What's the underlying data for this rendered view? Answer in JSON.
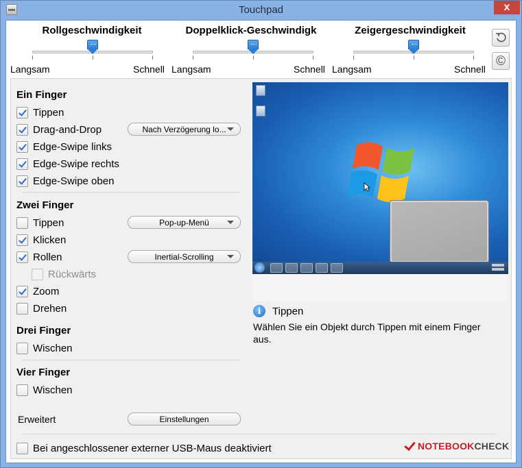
{
  "window": {
    "title": "Touchpad",
    "close_glyph": "x"
  },
  "sliders": [
    {
      "label": "Rollgeschwindigkeit",
      "min_label": "Langsam",
      "max_label": "Schnell",
      "value": 0.5
    },
    {
      "label": "Doppelklick-Geschwindigk",
      "min_label": "Langsam",
      "max_label": "Schnell",
      "value": 0.5
    },
    {
      "label": "Zeigergeschwindigkeit",
      "min_label": "Langsam",
      "max_label": "Schnell",
      "value": 0.5
    }
  ],
  "side_buttons": {
    "reset_icon": "undo-icon",
    "copyright_icon": "copyright-icon",
    "copyright_glyph": "©"
  },
  "sections": {
    "one_finger": {
      "title": "Ein Finger",
      "items": [
        {
          "label": "Tippen",
          "checked": true
        },
        {
          "label": "Drag-and-Drop",
          "checked": true,
          "dropdown": "Nach Verzögerung lo..."
        },
        {
          "label": "Edge-Swipe links",
          "checked": true
        },
        {
          "label": "Edge-Swipe rechts",
          "checked": true
        },
        {
          "label": "Edge-Swipe oben",
          "checked": true
        }
      ]
    },
    "two_finger": {
      "title": "Zwei Finger",
      "items": [
        {
          "label": "Tippen",
          "checked": false,
          "dropdown": "Pop-up-Menü"
        },
        {
          "label": "Klicken",
          "checked": true
        },
        {
          "label": "Rollen",
          "checked": true,
          "dropdown": "Inertial-Scrolling"
        },
        {
          "label": "Rückwärts",
          "checked": false,
          "disabled": true
        },
        {
          "label": "Zoom",
          "checked": true
        },
        {
          "label": "Drehen",
          "checked": false
        }
      ]
    },
    "three_finger": {
      "title": "Drei Finger",
      "items": [
        {
          "label": "Wischen",
          "checked": false
        }
      ]
    },
    "four_finger": {
      "title": "Vier Finger",
      "items": [
        {
          "label": "Wischen",
          "checked": false
        }
      ]
    }
  },
  "advanced": {
    "label": "Erweitert",
    "button": "Einstellungen"
  },
  "usb_option": {
    "label": "Bei angeschlossener externer USB-Maus deaktiviert",
    "checked": false
  },
  "info": {
    "icon": "info-icon",
    "icon_glyph": "i",
    "title": "Tippen",
    "text": "Wählen Sie ein Objekt durch Tippen mit einem Finger aus."
  },
  "watermark": {
    "part1": "NOTEBOOK",
    "part2": "CHECK"
  },
  "colors": {
    "accent": "#2a7fd4",
    "titlebar": "#8ab1e4",
    "close": "#c7463b",
    "watermark": "#c32026"
  }
}
